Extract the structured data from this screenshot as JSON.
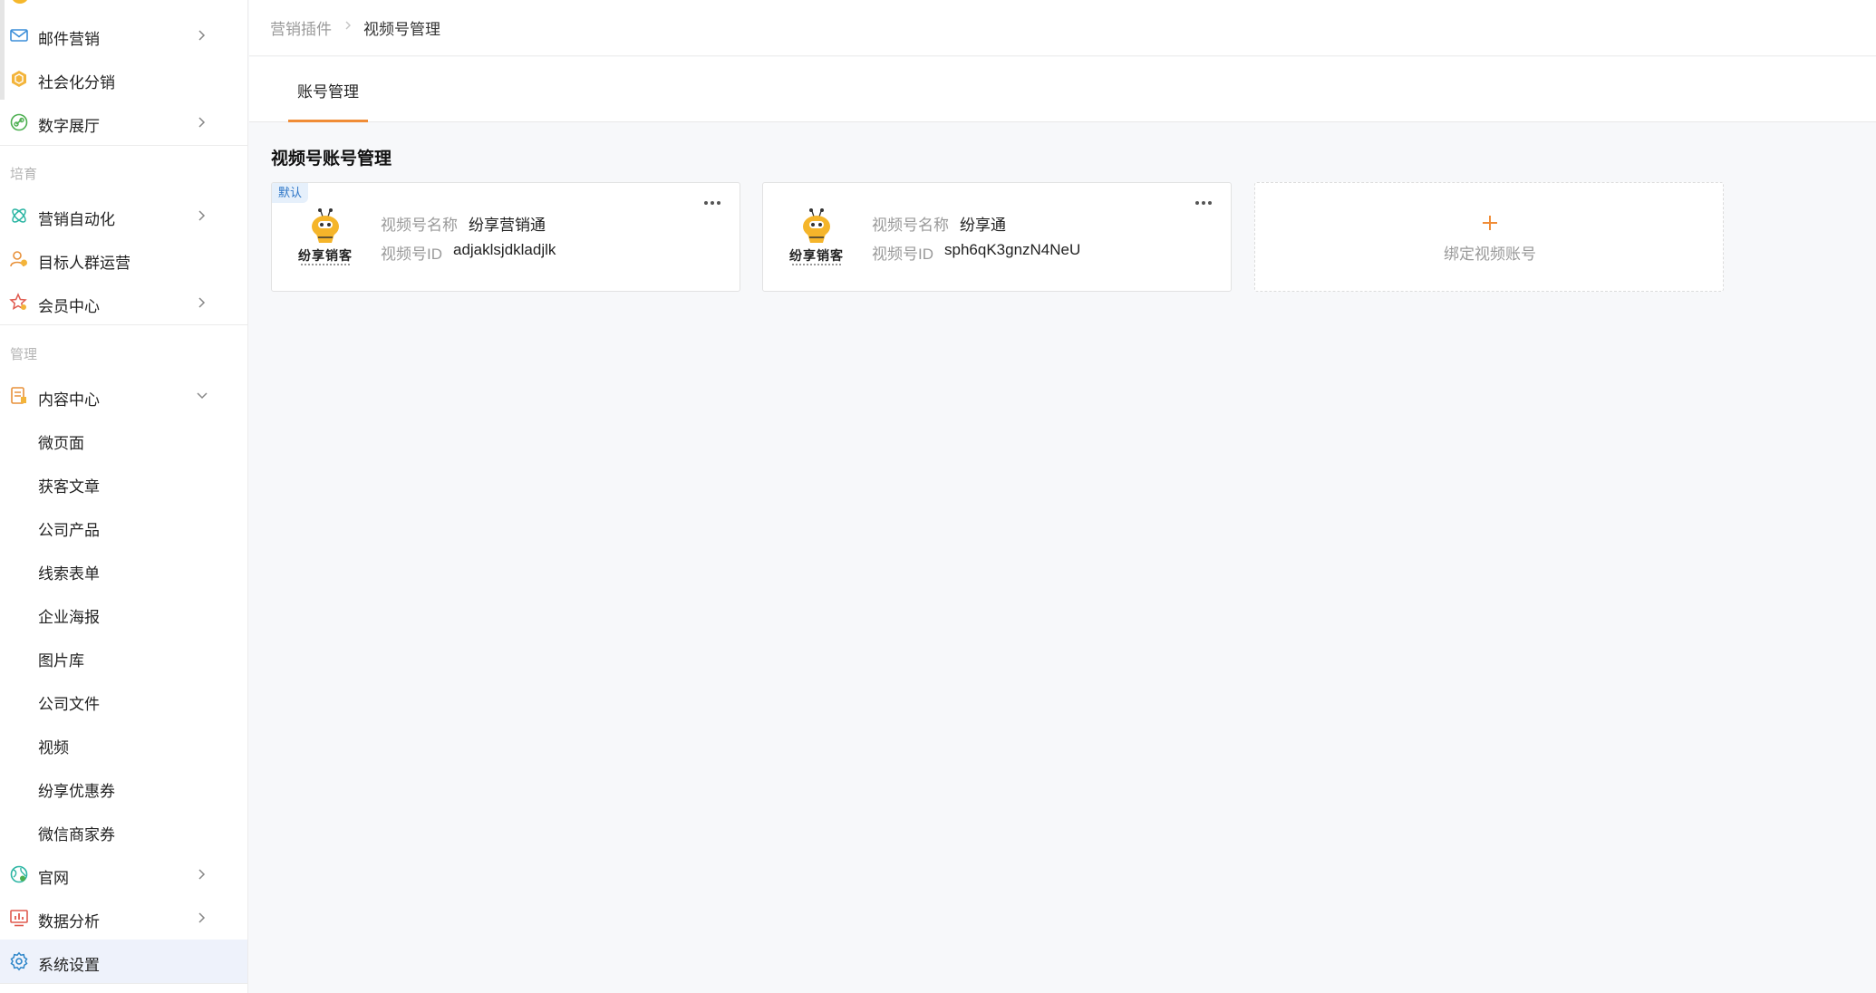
{
  "sidebar": {
    "items_top": [
      {
        "label": "邮件营销",
        "icon": "mail-icon"
      },
      {
        "label": "社会化分销",
        "icon": "hexagon-icon"
      },
      {
        "label": "数字展厅",
        "icon": "link-icon"
      }
    ],
    "section_nurture": "培育",
    "items_nurture": [
      {
        "label": "营销自动化",
        "icon": "automation-icon"
      },
      {
        "label": "目标人群运营",
        "icon": "users-icon"
      },
      {
        "label": "会员中心",
        "icon": "star-user-icon"
      }
    ],
    "section_manage": "管理",
    "content_center": {
      "label": "内容中心",
      "icon": "document-icon"
    },
    "content_sub": [
      "微页面",
      "获客文章",
      "公司产品",
      "线索表单",
      "企业海报",
      "图片库",
      "公司文件",
      "视频",
      "纷享优惠券",
      "微信商家券"
    ],
    "items_bottom": [
      {
        "label": "官网",
        "icon": "globe-icon"
      },
      {
        "label": "数据分析",
        "icon": "chart-icon"
      }
    ],
    "settings": {
      "label": "系统设置",
      "icon": "gear-icon"
    }
  },
  "breadcrumb": {
    "parent": "营销插件",
    "current": "视频号管理"
  },
  "tabs": [
    {
      "label": "账号管理"
    }
  ],
  "section_title": "视频号账号管理",
  "cards": [
    {
      "badge": "默认",
      "logo_text": "纷享销客",
      "name_label": "视频号名称",
      "name": "纷享营销通",
      "id_label": "视频号ID",
      "id": "adjaklsjdkladjlk"
    },
    {
      "logo_text": "纷享销客",
      "name_label": "视频号名称",
      "name": "纷享通",
      "id_label": "视频号ID",
      "id": "sph6qK3gnzN4NeU"
    }
  ],
  "add_card": {
    "label": "绑定视频账号"
  },
  "colors": {
    "accent": "#f08c36",
    "badge_blue": "#2b74c6",
    "active_bg": "#eef2fb"
  }
}
